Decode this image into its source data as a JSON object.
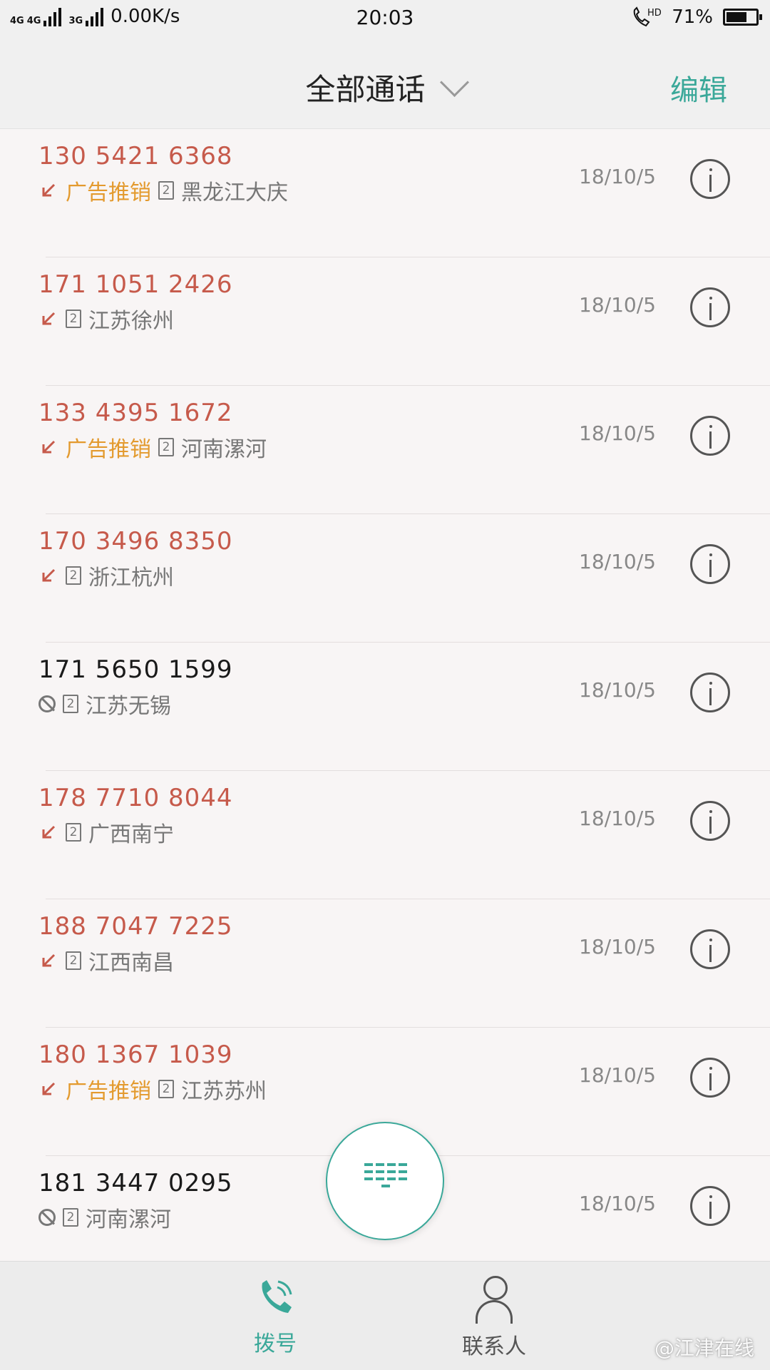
{
  "status_bar": {
    "network_left": "4G",
    "network_right": "4G",
    "network_3g": "3G",
    "speed": "0.00K/s",
    "time": "20:03",
    "hd": "HD",
    "battery": "71%",
    "battery_level": 0.71
  },
  "header": {
    "title": "全部通话",
    "edit_label": "编辑"
  },
  "calls": [
    {
      "number": "130 5421 6368",
      "missed": true,
      "tag": "广告推销",
      "sim": "2",
      "location": "黑龙江大庆",
      "date": "18/10/5"
    },
    {
      "number": "171 1051 2426",
      "missed": true,
      "tag": "",
      "sim": "2",
      "location": "江苏徐州",
      "date": "18/10/5"
    },
    {
      "number": "133 4395 1672",
      "missed": true,
      "tag": "广告推销",
      "sim": "2",
      "location": "河南漯河",
      "date": "18/10/5"
    },
    {
      "number": "170 3496 8350",
      "missed": true,
      "tag": "",
      "sim": "2",
      "location": "浙江杭州",
      "date": "18/10/5"
    },
    {
      "number": "171 5650 1599",
      "missed": false,
      "tag": "",
      "sim": "2",
      "location": "江苏无锡",
      "date": "18/10/5"
    },
    {
      "number": "178 7710 8044",
      "missed": true,
      "tag": "",
      "sim": "2",
      "location": "广西南宁",
      "date": "18/10/5"
    },
    {
      "number": "188 7047 7225",
      "missed": true,
      "tag": "",
      "sim": "2",
      "location": "江西南昌",
      "date": "18/10/5"
    },
    {
      "number": "180 1367 1039",
      "missed": true,
      "tag": "广告推销",
      "sim": "2",
      "location": "江苏苏州",
      "date": "18/10/5"
    },
    {
      "number": "181 3447 0295",
      "missed": false,
      "tag": "",
      "sim": "2",
      "location": "河南漯河",
      "date": "18/10/5"
    }
  ],
  "bottom_nav": {
    "dial_label": "拨号",
    "contacts_label": "联系人"
  },
  "watermark": "@江津在线",
  "colors": {
    "accent": "#3aa899",
    "missed_number": "#c65a4b",
    "tag": "#e39a2e"
  }
}
